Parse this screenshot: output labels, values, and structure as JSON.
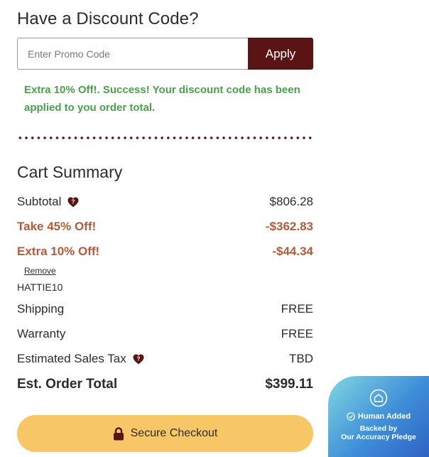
{
  "discount": {
    "title": "Have a Discount Code?",
    "placeholder": "Enter Promo Code",
    "apply_label": "Apply",
    "success_message": "Extra 10% Off!. Success! Your discount code has been applied to you order total."
  },
  "summary": {
    "title": "Cart Summary",
    "subtotal_label": "Subtotal",
    "subtotal_value": "$806.28",
    "discount1_label": "Take 45% Off!",
    "discount1_value": "-$362.83",
    "discount2_label": "Extra 10% Off!",
    "discount2_value": "-$44.34",
    "remove_label": "Remove",
    "code": "HATTIE10",
    "shipping_label": "Shipping",
    "shipping_value": "FREE",
    "warranty_label": "Warranty",
    "warranty_value": "FREE",
    "tax_label": "Estimated Sales Tax",
    "tax_value": "TBD",
    "total_label": "Est. Order Total",
    "total_value": "$399.11"
  },
  "checkout": {
    "label": "Secure Checkout",
    "icon": "lock-icon"
  },
  "badge": {
    "title": "Human Added",
    "line1": "Backed by",
    "line2": "Our Accuracy Pledge",
    "icon": "house-icon"
  },
  "colors": {
    "brand": "#5a1414",
    "success": "#4aa14a",
    "discount": "#b5593a",
    "checkout": "#f6c667",
    "badge_gradient_start": "#7fd7e0",
    "badge_gradient_end": "#2f62c4"
  }
}
